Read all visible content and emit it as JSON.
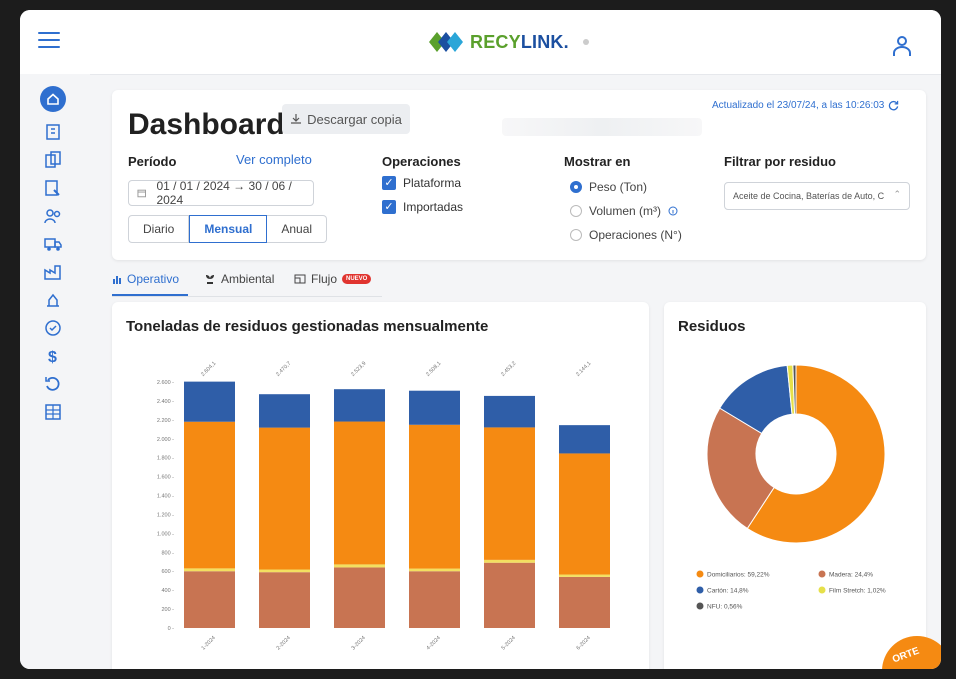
{
  "topbar": {
    "logo_re": "RECY",
    "logo_link": "LINK."
  },
  "header": {
    "title": "Dashboard",
    "download_label": "Descargar copia",
    "updated_text": "Actualizado el 23/07/24, a las 10:26:03"
  },
  "filters": {
    "periodo_label": "Período",
    "ver_completo": "Ver completo",
    "date_range": "01 / 01 / 2024 → 30 / 06 / 2024",
    "granularity": [
      "Diario",
      "Mensual",
      "Anual"
    ],
    "granularity_selected": "Mensual",
    "operaciones_label": "Operaciones",
    "operaciones": [
      {
        "label": "Plataforma",
        "checked": true
      },
      {
        "label": "Importadas",
        "checked": true
      }
    ],
    "mostrar_label": "Mostrar en",
    "mostrar": [
      {
        "label": "Peso (Ton)",
        "selected": true
      },
      {
        "label": "Volumen (m³)",
        "selected": false
      },
      {
        "label": "Operaciones (N°)",
        "selected": false
      }
    ],
    "residuo_label": "Filtrar por residuo",
    "residuo_value": "Aceite de Cocina, Baterías de Auto, C"
  },
  "tabs": [
    {
      "label": "Operativo",
      "icon": "bar-chart-icon",
      "active": true
    },
    {
      "label": "Ambiental",
      "icon": "plant-icon",
      "active": false
    },
    {
      "label": "Flujo",
      "icon": "flow-icon",
      "active": false,
      "badge": "NUEVO"
    }
  ],
  "corner_badge": "ORTE",
  "chart_data": [
    {
      "type": "bar",
      "stacked": true,
      "title": "Toneladas de residuos gestionadas mensualmente",
      "categories": [
        "1-2024",
        "2-2024",
        "3-2024",
        "4-2024",
        "5-2024",
        "6-2024"
      ],
      "totals": [
        "2.604,1",
        "2.470,7",
        "2.523,9",
        "2.508,1",
        "2.453,2",
        "2.144,1"
      ],
      "series": [
        {
          "name": "Madera",
          "color": "#c87452",
          "values": [
            600,
            590,
            640,
            600,
            690,
            540
          ]
        },
        {
          "name": "Film Stretch",
          "color": "#f3df60",
          "values": [
            30,
            28,
            32,
            28,
            30,
            25
          ]
        },
        {
          "name": "Domiciliarios",
          "color": "#f58a12",
          "values": [
            1550,
            1500,
            1510,
            1520,
            1400,
            1280
          ]
        },
        {
          "name": "Cartón",
          "color": "#2f5ea8",
          "values": [
            424,
            353,
            342,
            360,
            333,
            299
          ]
        }
      ],
      "yticks": [
        0,
        200,
        400,
        600,
        800,
        1000,
        1200,
        1400,
        1600,
        1800,
        2000,
        2200,
        2400,
        2600
      ],
      "ytick_labels": [
        "0 -",
        "200 -",
        "400 -",
        "600 -",
        "800 -",
        "1.000 -",
        "1.200 -",
        "1.400 -",
        "1.600 -",
        "1.800 -",
        "2.000 -",
        "2.200 -",
        "2.400 -",
        "2.600 -"
      ],
      "ylim": [
        0,
        2600
      ],
      "grid": false
    },
    {
      "type": "pie",
      "donut": true,
      "title": "Residuos",
      "slices": [
        {
          "name": "Domiciliarios",
          "label": "Domiciliarios: 59,22%",
          "value": 59.22,
          "color": "#f58a12"
        },
        {
          "name": "Madera",
          "label": "Madera: 24,4%",
          "value": 24.4,
          "color": "#c87452"
        },
        {
          "name": "Cartón",
          "label": "Cartón: 14,8%",
          "value": 14.8,
          "color": "#2f5ea8"
        },
        {
          "name": "Film Stretch",
          "label": "Film Stretch: 1,02%",
          "value": 1.02,
          "color": "#e6e04a"
        },
        {
          "name": "NFU",
          "label": "NFU: 0,56%",
          "value": 0.56,
          "color": "#555555"
        }
      ],
      "legend_position": "bottom"
    }
  ]
}
